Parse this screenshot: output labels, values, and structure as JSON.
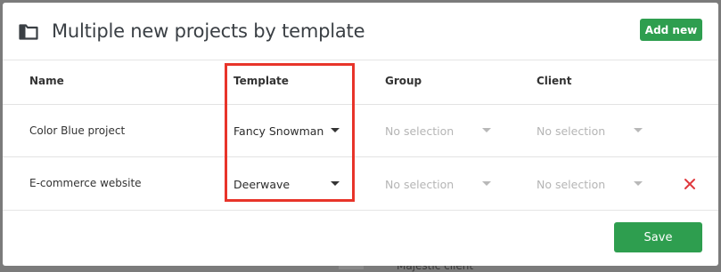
{
  "modal": {
    "title": "Multiple new projects by template",
    "add_new_label": "Add new",
    "save_label": "Save"
  },
  "columns": [
    "Name",
    "Template",
    "Group",
    "Client"
  ],
  "rows": [
    {
      "name": "Color Blue project",
      "template": "Fancy Snowman",
      "group": "No selection",
      "client": "No selection",
      "removable": false
    },
    {
      "name": "E-commerce website",
      "template": "Deerwave",
      "group": "No selection",
      "client": "No selection",
      "removable": true
    }
  ],
  "background": {
    "peek_text": "Majestic client"
  },
  "icons": {
    "title": "folder-icon",
    "remove": "close-icon",
    "dropdown": "caret-down-icon"
  },
  "colors": {
    "primary": "#2e9e4f",
    "highlight": "#e8342a",
    "danger": "#e0393e"
  }
}
